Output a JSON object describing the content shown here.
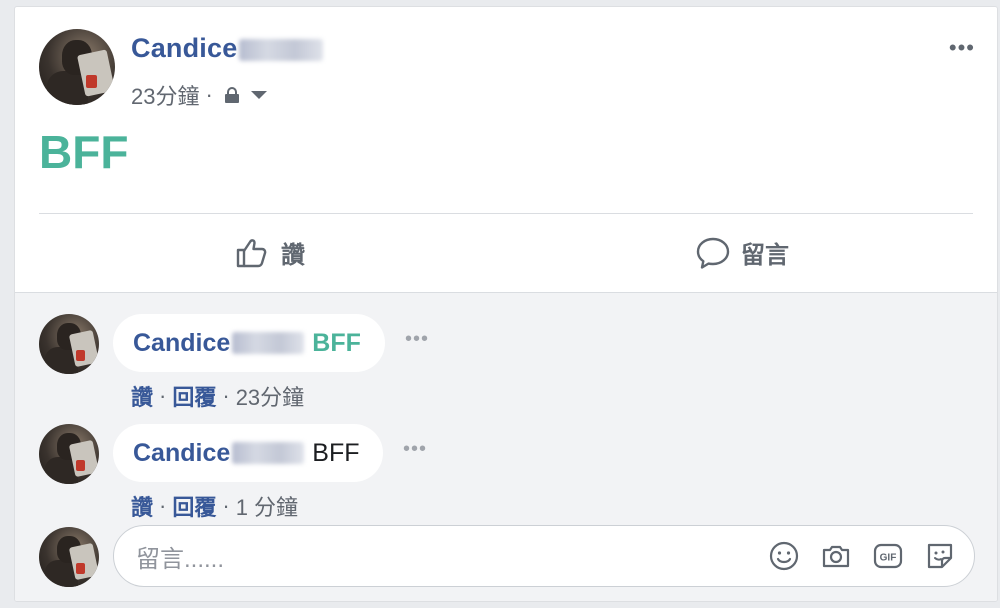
{
  "post": {
    "author": "Candice",
    "time": "23分鐘",
    "separator": "·",
    "text": "BFF"
  },
  "actions": {
    "like": "讚",
    "comment": "留言"
  },
  "comments": [
    {
      "author": "Candice",
      "text": "BFF",
      "like": "讚",
      "reply": "回覆",
      "separator": "·",
      "time": "23分鐘",
      "text_color": "#4bb39a"
    },
    {
      "author": "Candice",
      "text": "BFF",
      "like": "讚",
      "reply": "回覆",
      "separator": "·",
      "time": "1 分鐘",
      "text_color": "#1c1e21"
    }
  ],
  "composer": {
    "placeholder": "留言......",
    "icons": [
      "emoji-icon",
      "camera-icon",
      "gif-icon",
      "sticker-icon"
    ]
  },
  "colors": {
    "link": "#385898",
    "accent": "#4bb39a",
    "muted": "#616770"
  }
}
